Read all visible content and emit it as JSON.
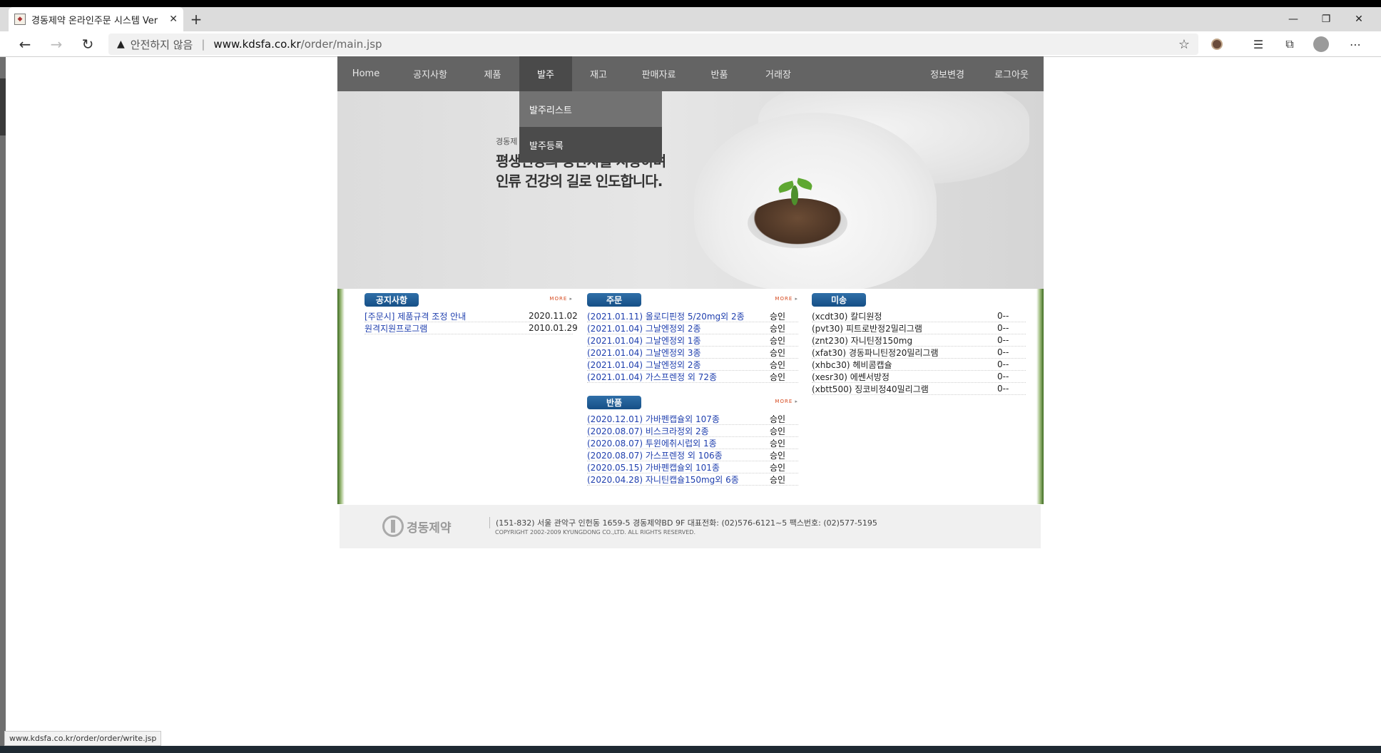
{
  "browser": {
    "tab_title": "경동제약 온라인주문 시스템 Ver",
    "tab_close": "✕",
    "new_tab": "+",
    "security_label": "안전하지 않음",
    "url_host": "www.kdsfa.co.kr",
    "url_path": "/order/main.jsp",
    "status_url": "www.kdsfa.co.kr/order/order/write.jsp"
  },
  "nav": {
    "items": [
      {
        "label": "Home"
      },
      {
        "label": "공지사항"
      },
      {
        "label": "제품"
      },
      {
        "label": "발주"
      },
      {
        "label": "재고"
      },
      {
        "label": "판매자료"
      },
      {
        "label": "반품"
      },
      {
        "label": "거래장"
      },
      {
        "label": "정보변경"
      },
      {
        "label": "로그아웃"
      }
    ],
    "active": "발주",
    "submenu": [
      {
        "label": "발주리스트"
      },
      {
        "label": "발주등록"
      }
    ]
  },
  "hero": {
    "small": "경동제",
    "line1": "평생건강의 동반자를 지향하며",
    "line2": "인류 건강의 길로 인도합니다."
  },
  "notice": {
    "title": "공지사항",
    "more": "MORE",
    "rows": [
      {
        "title": "[주문시] 제품규격 조정 안내",
        "date": "2020.11.02"
      },
      {
        "title": "원격지원프로그램",
        "date": "2010.01.29"
      }
    ]
  },
  "orders": {
    "title": "주문",
    "more": "MORE",
    "rows": [
      {
        "title": "(2021.01.11) 올로디핀정 5/20mg외 2종",
        "status": "승인"
      },
      {
        "title": "(2021.01.04) 그날엔정외 2종",
        "status": "승인"
      },
      {
        "title": "(2021.01.04) 그날엔정외 1종",
        "status": "승인"
      },
      {
        "title": "(2021.01.04) 그날엔정외 3종",
        "status": "승인"
      },
      {
        "title": "(2021.01.04) 그날엔정외 2종",
        "status": "승인"
      },
      {
        "title": "(2021.01.04) 가스프렌정 외 72종",
        "status": "승인"
      }
    ]
  },
  "returns": {
    "title": "반품",
    "more": "MORE",
    "rows": [
      {
        "title": "(2020.12.01) 가바펜캡슐외 107종",
        "status": "승인"
      },
      {
        "title": "(2020.08.07) 비스크라정외 2종",
        "status": "승인"
      },
      {
        "title": "(2020.08.07) 투윈에취시럽외 1종",
        "status": "승인"
      },
      {
        "title": "(2020.08.07) 가스프렌정 외 106종",
        "status": "승인"
      },
      {
        "title": "(2020.05.15) 가바펜캡슐외 101종",
        "status": "승인"
      },
      {
        "title": "(2020.04.28) 자니틴캡슐150mg외 6종",
        "status": "승인"
      }
    ]
  },
  "undelivered": {
    "title": "미송",
    "rows": [
      {
        "title": "(xcdt30) 칼디원정",
        "qty": "0--"
      },
      {
        "title": "(pvt30) 피트로반정2밀리그램",
        "qty": "0--"
      },
      {
        "title": "(znt230) 자니틴정150mg",
        "qty": "0--"
      },
      {
        "title": "(xfat30) 경동파니틴정20밀리그램",
        "qty": "0--"
      },
      {
        "title": "(xhbc30) 헤비콤캡슐",
        "qty": "0--"
      },
      {
        "title": "(xesr30) 에쎈서방정",
        "qty": "0--"
      },
      {
        "title": "(xbtt500) 징코비정40밀리그램",
        "qty": "0--"
      }
    ]
  },
  "footer": {
    "logo": "경동제약",
    "address": "(151-832) 서울 관악구 인헌동 1659-5 경동제약BD 9F 대표전화: (02)576-6121~5 팩스번호: (02)577-5195",
    "copyright": "COPYRIGHT 2002-2009 KYUNGDONG CO.,LTD.  ALL RIGHTS RESERVED."
  }
}
